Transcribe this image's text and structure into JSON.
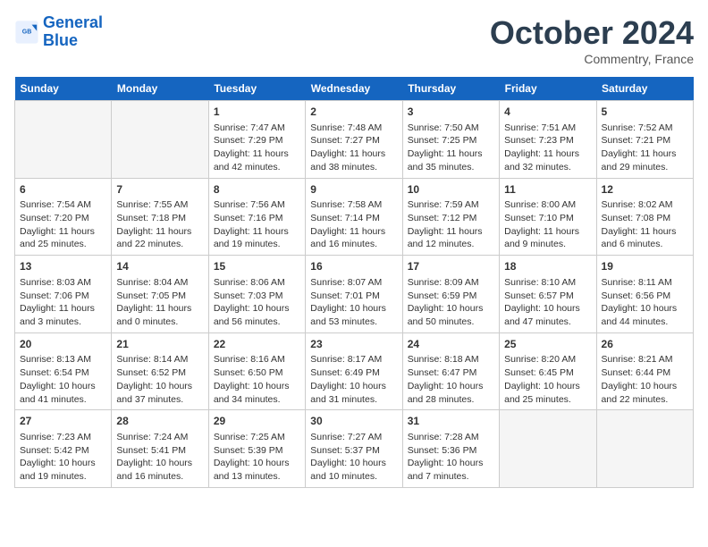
{
  "header": {
    "logo_line1": "General",
    "logo_line2": "Blue",
    "month": "October 2024",
    "location": "Commentry, France"
  },
  "days_of_week": [
    "Sunday",
    "Monday",
    "Tuesday",
    "Wednesday",
    "Thursday",
    "Friday",
    "Saturday"
  ],
  "weeks": [
    [
      {
        "day": "",
        "info": ""
      },
      {
        "day": "",
        "info": ""
      },
      {
        "day": "1",
        "sunrise": "7:47 AM",
        "sunset": "7:29 PM",
        "daylight": "11 hours and 42 minutes."
      },
      {
        "day": "2",
        "sunrise": "7:48 AM",
        "sunset": "7:27 PM",
        "daylight": "11 hours and 38 minutes."
      },
      {
        "day": "3",
        "sunrise": "7:50 AM",
        "sunset": "7:25 PM",
        "daylight": "11 hours and 35 minutes."
      },
      {
        "day": "4",
        "sunrise": "7:51 AM",
        "sunset": "7:23 PM",
        "daylight": "11 hours and 32 minutes."
      },
      {
        "day": "5",
        "sunrise": "7:52 AM",
        "sunset": "7:21 PM",
        "daylight": "11 hours and 29 minutes."
      }
    ],
    [
      {
        "day": "6",
        "sunrise": "7:54 AM",
        "sunset": "7:20 PM",
        "daylight": "11 hours and 25 minutes."
      },
      {
        "day": "7",
        "sunrise": "7:55 AM",
        "sunset": "7:18 PM",
        "daylight": "11 hours and 22 minutes."
      },
      {
        "day": "8",
        "sunrise": "7:56 AM",
        "sunset": "7:16 PM",
        "daylight": "11 hours and 19 minutes."
      },
      {
        "day": "9",
        "sunrise": "7:58 AM",
        "sunset": "7:14 PM",
        "daylight": "11 hours and 16 minutes."
      },
      {
        "day": "10",
        "sunrise": "7:59 AM",
        "sunset": "7:12 PM",
        "daylight": "11 hours and 12 minutes."
      },
      {
        "day": "11",
        "sunrise": "8:00 AM",
        "sunset": "7:10 PM",
        "daylight": "11 hours and 9 minutes."
      },
      {
        "day": "12",
        "sunrise": "8:02 AM",
        "sunset": "7:08 PM",
        "daylight": "11 hours and 6 minutes."
      }
    ],
    [
      {
        "day": "13",
        "sunrise": "8:03 AM",
        "sunset": "7:06 PM",
        "daylight": "11 hours and 3 minutes."
      },
      {
        "day": "14",
        "sunrise": "8:04 AM",
        "sunset": "7:05 PM",
        "daylight": "11 hours and 0 minutes."
      },
      {
        "day": "15",
        "sunrise": "8:06 AM",
        "sunset": "7:03 PM",
        "daylight": "10 hours and 56 minutes."
      },
      {
        "day": "16",
        "sunrise": "8:07 AM",
        "sunset": "7:01 PM",
        "daylight": "10 hours and 53 minutes."
      },
      {
        "day": "17",
        "sunrise": "8:09 AM",
        "sunset": "6:59 PM",
        "daylight": "10 hours and 50 minutes."
      },
      {
        "day": "18",
        "sunrise": "8:10 AM",
        "sunset": "6:57 PM",
        "daylight": "10 hours and 47 minutes."
      },
      {
        "day": "19",
        "sunrise": "8:11 AM",
        "sunset": "6:56 PM",
        "daylight": "10 hours and 44 minutes."
      }
    ],
    [
      {
        "day": "20",
        "sunrise": "8:13 AM",
        "sunset": "6:54 PM",
        "daylight": "10 hours and 41 minutes."
      },
      {
        "day": "21",
        "sunrise": "8:14 AM",
        "sunset": "6:52 PM",
        "daylight": "10 hours and 37 minutes."
      },
      {
        "day": "22",
        "sunrise": "8:16 AM",
        "sunset": "6:50 PM",
        "daylight": "10 hours and 34 minutes."
      },
      {
        "day": "23",
        "sunrise": "8:17 AM",
        "sunset": "6:49 PM",
        "daylight": "10 hours and 31 minutes."
      },
      {
        "day": "24",
        "sunrise": "8:18 AM",
        "sunset": "6:47 PM",
        "daylight": "10 hours and 28 minutes."
      },
      {
        "day": "25",
        "sunrise": "8:20 AM",
        "sunset": "6:45 PM",
        "daylight": "10 hours and 25 minutes."
      },
      {
        "day": "26",
        "sunrise": "8:21 AM",
        "sunset": "6:44 PM",
        "daylight": "10 hours and 22 minutes."
      }
    ],
    [
      {
        "day": "27",
        "sunrise": "7:23 AM",
        "sunset": "5:42 PM",
        "daylight": "10 hours and 19 minutes."
      },
      {
        "day": "28",
        "sunrise": "7:24 AM",
        "sunset": "5:41 PM",
        "daylight": "10 hours and 16 minutes."
      },
      {
        "day": "29",
        "sunrise": "7:25 AM",
        "sunset": "5:39 PM",
        "daylight": "10 hours and 13 minutes."
      },
      {
        "day": "30",
        "sunrise": "7:27 AM",
        "sunset": "5:37 PM",
        "daylight": "10 hours and 10 minutes."
      },
      {
        "day": "31",
        "sunrise": "7:28 AM",
        "sunset": "5:36 PM",
        "daylight": "10 hours and 7 minutes."
      },
      {
        "day": "",
        "info": ""
      },
      {
        "day": "",
        "info": ""
      }
    ]
  ]
}
